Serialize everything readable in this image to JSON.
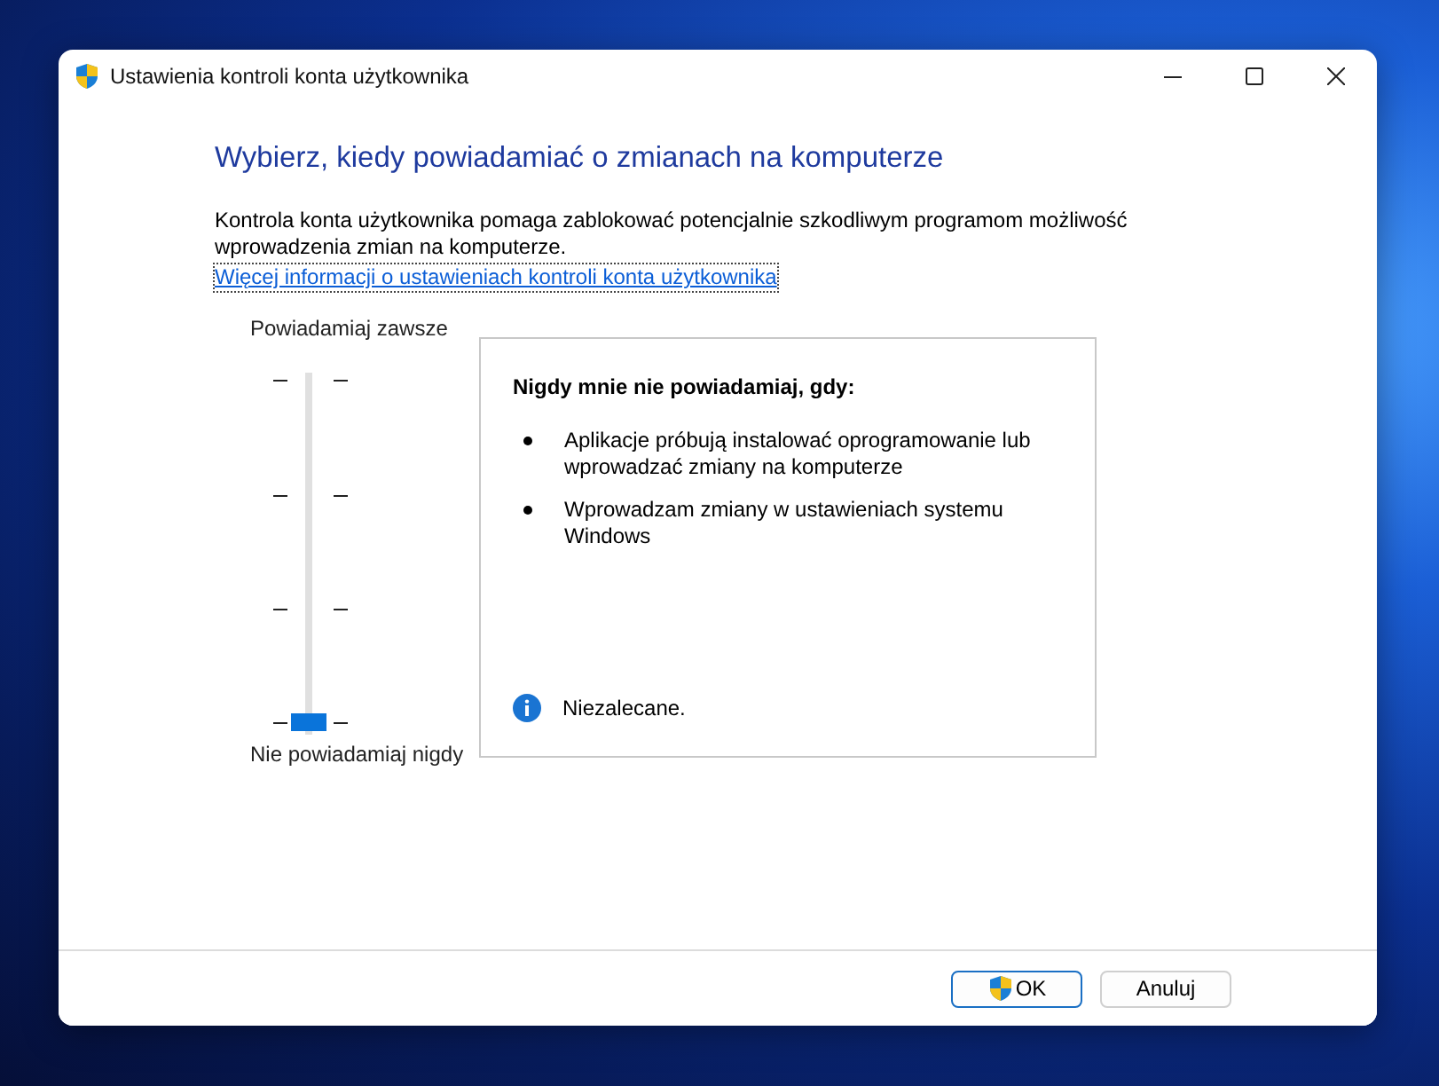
{
  "window": {
    "title": "Ustawienia kontroli konta użytkownika"
  },
  "heading": "Wybierz, kiedy powiadamiać o zmianach na komputerze",
  "description": "Kontrola konta użytkownika pomaga zablokować potencjalnie szkodliwym programom możliwość wprowadzenia zmian na komputerze.",
  "link": "Więcej informacji o ustawieniach kontroli konta użytkownika",
  "slider": {
    "top_label": "Powiadamiaj zawsze",
    "bottom_label": "Nie powiadamiaj nigdy",
    "level": 0
  },
  "panel": {
    "title": "Nigdy mnie nie powiadamiaj, gdy:",
    "bullets": [
      "Aplikacje próbują instalować oprogramowanie lub wprowadzać zmiany na komputerze",
      "Wprowadzam zmiany w ustawieniach systemu Windows"
    ],
    "note": "Niezalecane."
  },
  "buttons": [
    {
      "label": "OK",
      "shield": true,
      "default": true
    },
    {
      "label": "Anuluj",
      "shield": false,
      "default": false
    }
  ]
}
